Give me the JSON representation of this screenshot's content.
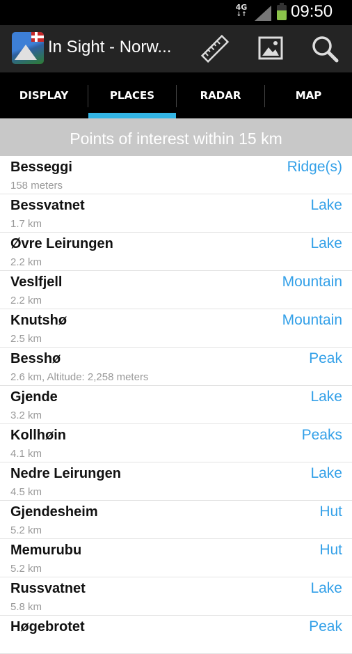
{
  "status_bar": {
    "network": "4G",
    "network_arrows": "↓↑",
    "time": "09:50"
  },
  "action_bar": {
    "title": "In Sight - Norw...",
    "icons": [
      "ruler-icon",
      "image-icon",
      "search-icon"
    ]
  },
  "tabs": [
    {
      "label": "DISPLAY",
      "selected": false
    },
    {
      "label": "PLACES",
      "selected": true
    },
    {
      "label": "RADAR",
      "selected": false
    },
    {
      "label": "MAP",
      "selected": false
    }
  ],
  "header": {
    "title": "Points of interest within 15 km"
  },
  "places": [
    {
      "name": "Besseggi",
      "detail": "158 meters",
      "type": "Ridge(s)"
    },
    {
      "name": "Bessvatnet",
      "detail": "1.7 km",
      "type": "Lake"
    },
    {
      "name": "Øvre Leirungen",
      "detail": "2.2 km",
      "type": "Lake"
    },
    {
      "name": "Veslfjell",
      "detail": "2.2 km",
      "type": "Mountain"
    },
    {
      "name": "Knutshø",
      "detail": "2.5 km",
      "type": "Mountain"
    },
    {
      "name": "Besshø",
      "detail": "2.6 km, Altitude: 2,258 meters",
      "type": "Peak"
    },
    {
      "name": "Gjende",
      "detail": "3.2 km",
      "type": "Lake"
    },
    {
      "name": "Kollhøin",
      "detail": "4.1 km",
      "type": "Peaks"
    },
    {
      "name": "Nedre Leirungen",
      "detail": "4.5 km",
      "type": "Lake"
    },
    {
      "name": "Gjendesheim",
      "detail": "5.2 km",
      "type": "Hut"
    },
    {
      "name": "Memurubu",
      "detail": "5.2 km",
      "type": "Hut"
    },
    {
      "name": "Russvatnet",
      "detail": "5.8 km",
      "type": "Lake"
    },
    {
      "name": "Høgebrotet",
      "detail": "",
      "type": "Peak"
    }
  ],
  "colors": {
    "accent": "#33b5e5",
    "type_text": "#33a0e8",
    "header_bg": "#c8c8c8",
    "action_bar_bg": "#242424"
  }
}
